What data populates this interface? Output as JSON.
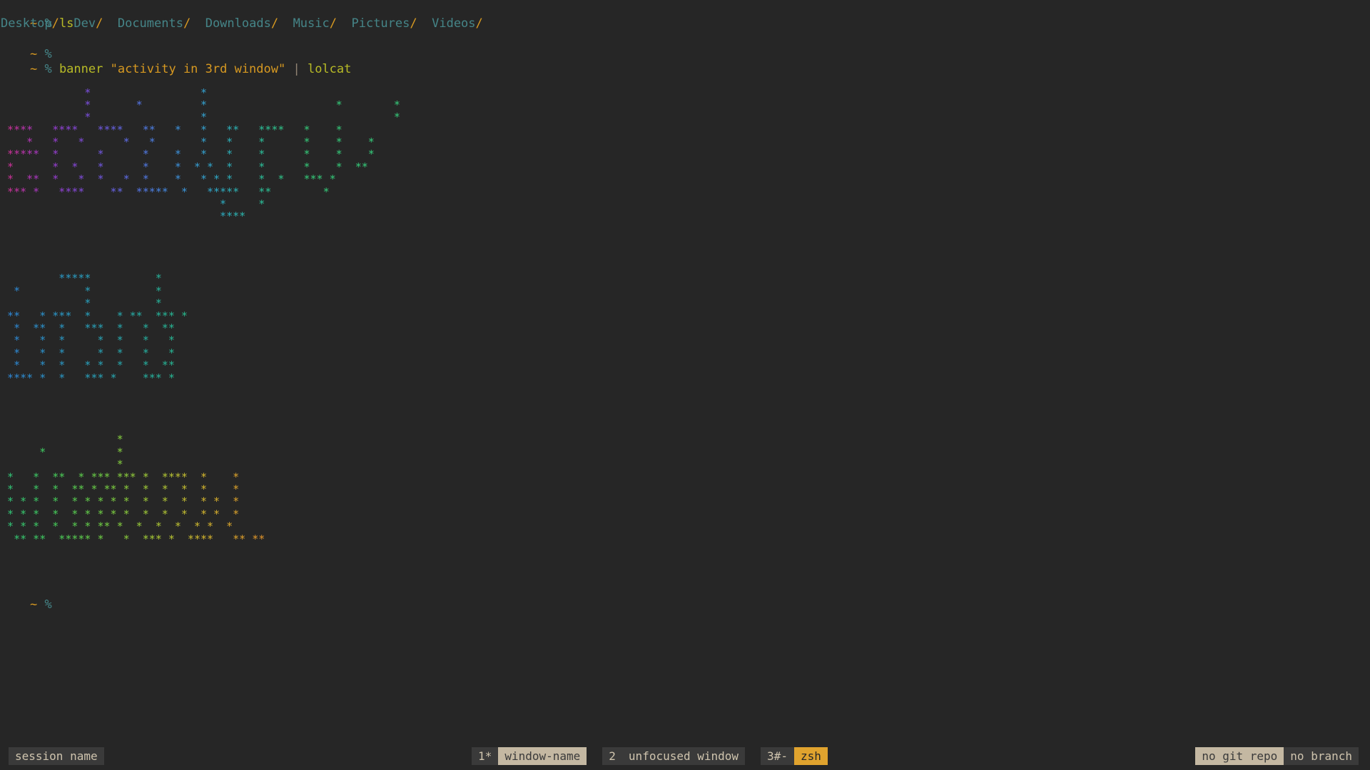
{
  "theme": {
    "background": "#262626",
    "prompt_symbol_color": "#d79921",
    "prompt_pct_color": "#458588",
    "command_color": "#b8bb26",
    "string_color": "#d79921",
    "dir_color": "#458588",
    "accent": "#e0a32e"
  },
  "terminal": {
    "lines": [
      {
        "type": "prompt",
        "tilde": "~",
        "pct": "%",
        "command": " ls"
      },
      {
        "type": "ls_output",
        "entries": [
          "Desktop",
          "Dev",
          "Documents",
          "Downloads",
          "Music",
          "Pictures",
          "Videos"
        ]
      },
      {
        "type": "prompt",
        "tilde": "~",
        "pct": "%",
        "command": ""
      },
      {
        "type": "prompt_banner",
        "tilde": "~",
        "pct": "%",
        "cmd": " banner ",
        "string": "\"activity in 3rd window\"",
        "pipe": " | ",
        "cmd2": "lolcat"
      },
      {
        "type": "blank"
      },
      {
        "type": "banner"
      },
      {
        "type": "blank"
      },
      {
        "type": "prompt",
        "tilde": "~",
        "pct": "%",
        "command": ""
      }
    ],
    "ls_slash": "/",
    "prompt_tilde": "~",
    "prompt_pct": "%"
  },
  "banner_text": "activity in 3rd window",
  "banner_blocks": [
    {
      "name": "block-1",
      "gradient": [
        "#d3308f",
        "#a03bd0",
        "#7b4fe0",
        "#5a6fe8",
        "#3f8fe0",
        "#2fa8c8",
        "#2bbf9e",
        "#35cc7a"
      ],
      "rows": [
        "             *                 *",
        "             *       *         *                    *        *",
        "             *                 *                             *",
        " ****   ****   ****   **   *   *   **   ****   *    *",
        "    *   *   *      *   *       *   *    *      *    *    *",
        " *****  *      *      *    *   *   *    *      *    *    *",
        " *      *  *   *      *    *  * *  *    *      *    *  **",
        " *  **  *   *  *   *  *    *   * * *    *  *   *** *",
        " *** *   ****    **  *****  *   *****   **        *",
        "                                  *     *",
        "                                  ****"
      ]
    },
    {
      "name": "block-2",
      "gradient": [
        "#2f86d8",
        "#2a9fc4",
        "#26b39e",
        "#2cc47a",
        "#3ad45f"
      ],
      "rows": [
        "         *****          *",
        "  *          *          *",
        "             *          *",
        " **   * ***  *    * **  *** *",
        "  *  **  *   ***  *   *  **",
        "  *   *  *     *  *   *   *",
        "  *   *  *     *  *   *   *",
        "  *   *  *   * *  *   *  **",
        " **** *  *   *** *    *** *"
      ]
    },
    {
      "name": "block-3",
      "gradient": [
        "#2fc47a",
        "#45cf5c",
        "#72d244",
        "#a8cc36",
        "#d4b82e",
        "#e09a2a",
        "#e08428"
      ],
      "rows": [
        "                  *",
        "      *           *",
        "                  *",
        " *   *  **  * *** *** *  ****  *    *",
        " *   *  *  ** * ** *  *  *  *  *    *",
        " * * *  *  * * * * *  *  *  *  * *  *",
        " * * *  *  * * * * *  *  *  *  * *  *",
        " * * *  *  * * ** *  *  *  *  * *  *",
        "  ** **  ***** *   *  *** *  ****   ** **"
      ]
    }
  ],
  "statusbar": {
    "session": {
      "label": "session name",
      "style": "dark"
    },
    "windows": [
      {
        "index": "1*",
        "name": "window-name",
        "active": true
      },
      {
        "index": "2",
        "name": "unfocused window",
        "active": false
      },
      {
        "index": "3#-",
        "name": "zsh",
        "active": false,
        "accent": true
      }
    ],
    "right": [
      {
        "label": "no git repo",
        "style": "light"
      },
      {
        "label": "no branch",
        "style": "dark"
      }
    ]
  }
}
